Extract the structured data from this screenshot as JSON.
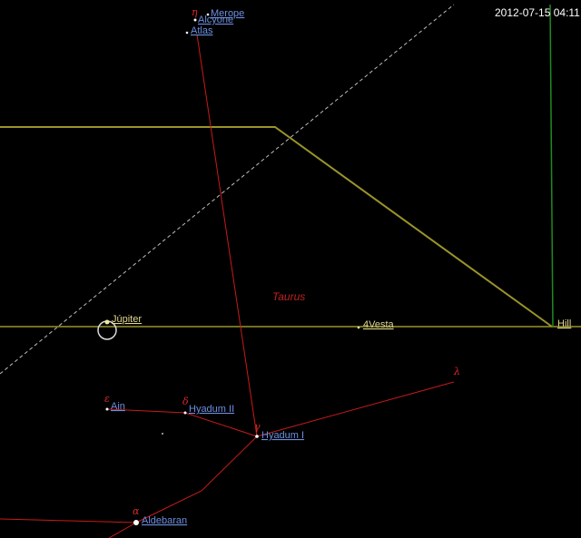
{
  "timestamp": "2012-07-15  04:11",
  "constellation": {
    "name": "Taurus"
  },
  "colors": {
    "background": "#000000",
    "constellation_line": "#c81a1a",
    "boundary": "#9a9428",
    "ecliptic": "#9a9428",
    "celestial_equator": "#bdbdbd",
    "meridian": "#1f8a1f",
    "star_label": "#6d8fe0",
    "planet_label": "#e0d890"
  },
  "stars": [
    {
      "name": "Merope"
    },
    {
      "name": "Alcyone"
    },
    {
      "name": "Atlas"
    },
    {
      "name": "Ain",
      "greek": "ε"
    },
    {
      "name": "Hyadum II",
      "greek": "δ"
    },
    {
      "name": "Hyadum I",
      "greek": "γ"
    },
    {
      "name": "Aldebaran",
      "greek": "α"
    },
    {
      "name": "",
      "greek": "λ"
    },
    {
      "name": "",
      "greek": "η"
    }
  ],
  "planets": [
    {
      "name": "Júpiter"
    },
    {
      "name": "4Vesta"
    },
    {
      "name": "Hill"
    }
  ]
}
